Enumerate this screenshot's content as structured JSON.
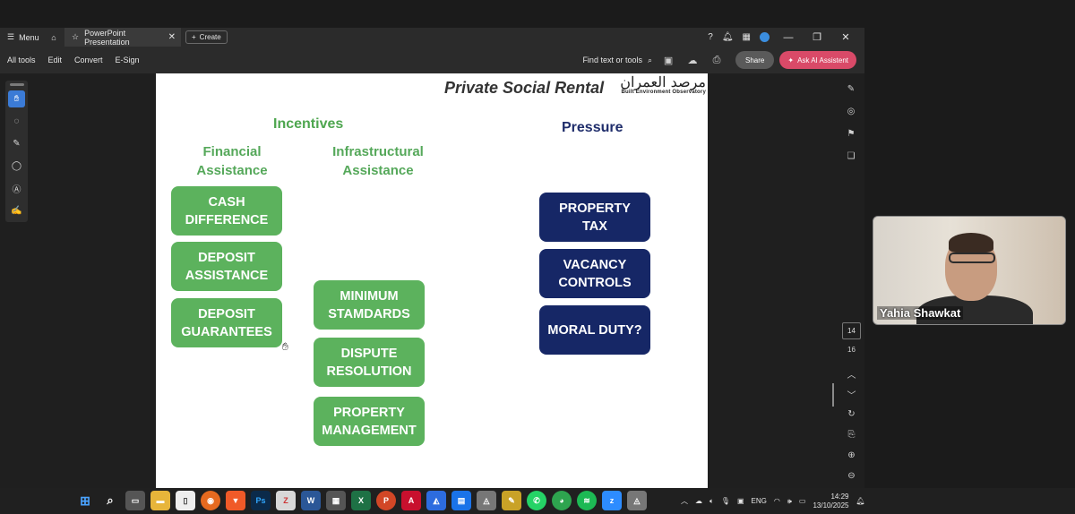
{
  "titlebar": {
    "menu_label": "Menu",
    "tab_label": "PowerPoint Presentation",
    "create_label": "Create"
  },
  "toolbar": {
    "items": [
      "All tools",
      "Edit",
      "Convert",
      "E-Sign"
    ],
    "find_label": "Find text or tools",
    "share_label": "Share",
    "ai_label": "Ask AI Assistent"
  },
  "slide": {
    "title": "Private Social Rental",
    "logo_arabic": "مرصد العمران",
    "logo_english": "Built Environment Observatory",
    "incentives_heading": "Incentives",
    "financial_heading": "Financial\nAssistance",
    "infrastructural_heading": "Infrastructural\nAssistance",
    "pressure_heading": "Pressure",
    "financial_boxes": [
      "CASH\nDIFFERENCE",
      "DEPOSIT\nASSISTANCE",
      "DEPOSIT\nGUARANTEES"
    ],
    "infrastructure_boxes": [
      "MINIMUM\nSTAMDARDS",
      "DISPUTE\nRESOLUTION",
      "PROPERTY\nMANAGEMENT"
    ],
    "pressure_boxes": [
      "PROPERTY\nTAX",
      "VACANCY\nCONTROLS",
      "MORAL DUTY?"
    ]
  },
  "pages": {
    "current": "14",
    "total": "16"
  },
  "video": {
    "participant_name": "Yahia Shawkat"
  },
  "taskbar": {
    "language": "ENG",
    "time": "14:29",
    "date": "13/10/2025"
  },
  "colors": {
    "green_box": "#5cb25d",
    "navy_box": "#162766",
    "ai_button": "#d94a68"
  }
}
